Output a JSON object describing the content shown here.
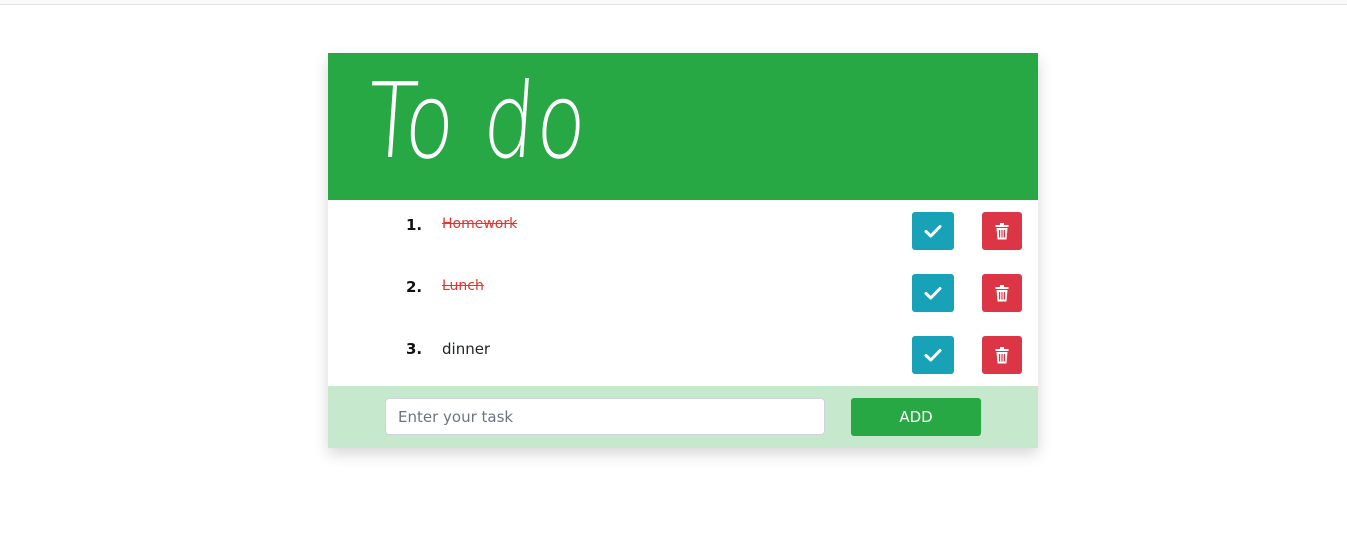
{
  "app": {
    "title": "To do"
  },
  "tasks": [
    {
      "number": "1.",
      "text": "Homework",
      "completed": true
    },
    {
      "number": "2.",
      "text": "Lunch",
      "completed": true
    },
    {
      "number": "3.",
      "text": "dinner",
      "completed": false
    }
  ],
  "actions": {
    "complete_icon": "check-icon",
    "delete_icon": "trash-icon"
  },
  "form": {
    "placeholder": "Enter your task",
    "value": "",
    "add_label": "ADD"
  },
  "colors": {
    "header": "#28a745",
    "complete_button": "#17a2b8",
    "delete_button": "#dc3545",
    "footer": "#c6e8cd",
    "completed_text": "#e3342f"
  }
}
